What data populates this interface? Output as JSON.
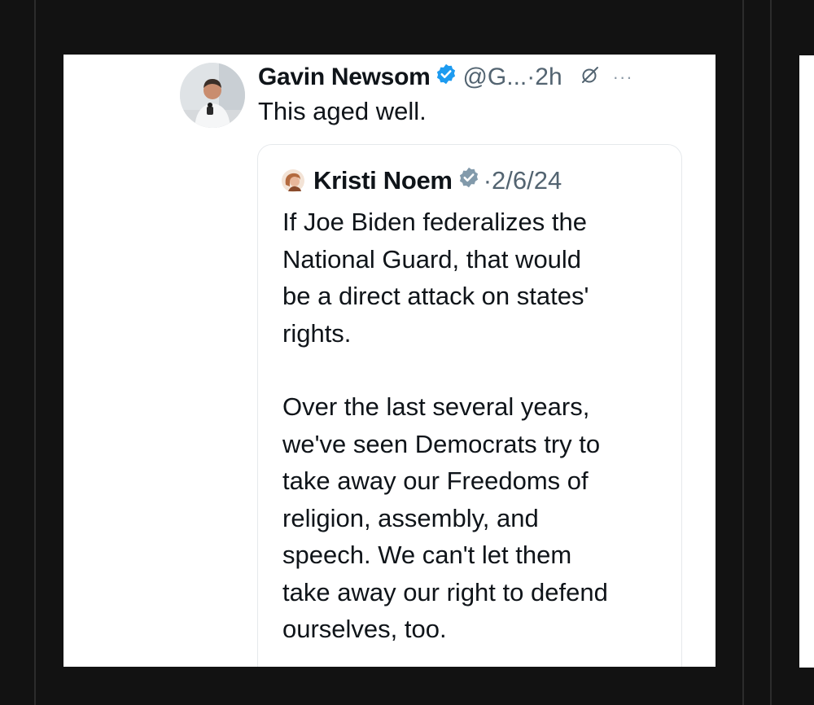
{
  "tweet": {
    "author_name": "Gavin Newsom",
    "handle": "@G...",
    "separator": "·",
    "time": "2h",
    "text": "This aged well.",
    "icons": {
      "verified": "verified-badge-icon",
      "grok": "grok-icon",
      "more": "more-icon"
    },
    "colors": {
      "verified": "#1d9bf0"
    }
  },
  "quoted_tweet": {
    "author_name": "Kristi Noem",
    "separator": "·",
    "date": "2/6/24",
    "badge_color": "#829aab",
    "lines_1": [
      "If Joe Biden federalizes the",
      "National Guard, that would",
      "be a direct attack on states'",
      "rights."
    ],
    "lines_2": [
      "Over the last several years,",
      "we've seen Democrats try to",
      "take away our Freedoms of",
      "religion, assembly, and",
      "speech. We can't let them",
      "take away our right to defend",
      "ourselves, too."
    ]
  }
}
